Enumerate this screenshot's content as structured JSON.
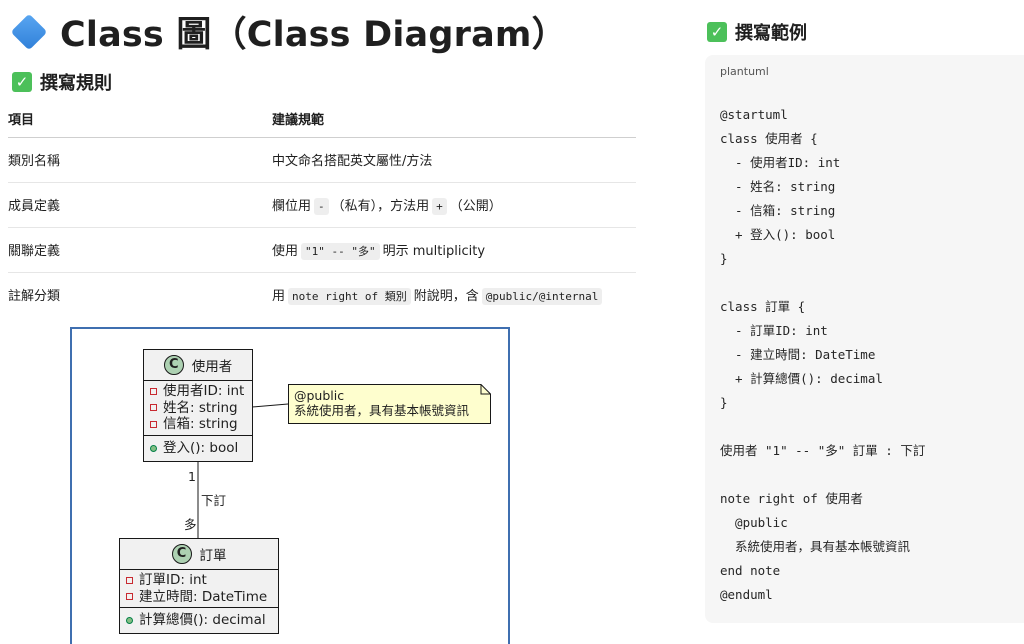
{
  "title": "Class 圖（Class Diagram）",
  "rules_heading": "撰寫規則",
  "example_heading": "撰寫範例",
  "table": {
    "headers": [
      "項目",
      "建議規範"
    ],
    "rows": [
      {
        "item": "類別名稱",
        "rule": "中文命名搭配英文屬性/方法"
      },
      {
        "item": "成員定義",
        "pre": "欄位用",
        "chip1": "-",
        "mid": "（私有），方法用",
        "chip2": "+",
        "post": "（公開）"
      },
      {
        "item": "關聯定義",
        "pre": "使用",
        "chip1": "\"1\" -- \"多\"",
        "post": "明示 multiplicity"
      },
      {
        "item": "註解分類",
        "pre": "用",
        "chip1": "note right of 類別",
        "mid": "附說明，含",
        "chip2": "@public/@internal"
      }
    ]
  },
  "diagram": {
    "class_user": {
      "badge": "C",
      "name": "使用者",
      "fields": [
        "使用者ID: int",
        "姓名: string",
        "信箱: string"
      ],
      "methods": [
        "登入(): bool"
      ]
    },
    "class_order": {
      "badge": "C",
      "name": "訂單",
      "fields": [
        "訂單ID: int",
        "建立時間: DateTime"
      ],
      "methods": [
        "計算總價(): decimal"
      ]
    },
    "note_lines": [
      "@public",
      "系統使用者，具有基本帳號資訊"
    ],
    "assoc_label": "下訂",
    "mult_top": "1",
    "mult_bottom": "多"
  },
  "example": {
    "lang": "plantuml",
    "code": "@startuml\nclass 使用者 {\n  - 使用者ID: int\n  - 姓名: string\n  - 信箱: string\n  + 登入(): bool\n}\n\nclass 訂單 {\n  - 訂單ID: int\n  - 建立時間: DateTime\n  + 計算總價(): decimal\n}\n\n使用者 \"1\" -- \"多\" 訂單 : 下訂\n\nnote right of 使用者\n  @public\n  系統使用者，具有基本帳號資訊\nend note\n@enduml"
  },
  "colors": {
    "accent_check": "#4cc05a",
    "diamond": "#2f7fd8",
    "diagram_border": "#3f6fb0",
    "note_fill": "#fefece",
    "class_fill": "#f1f1f1"
  }
}
